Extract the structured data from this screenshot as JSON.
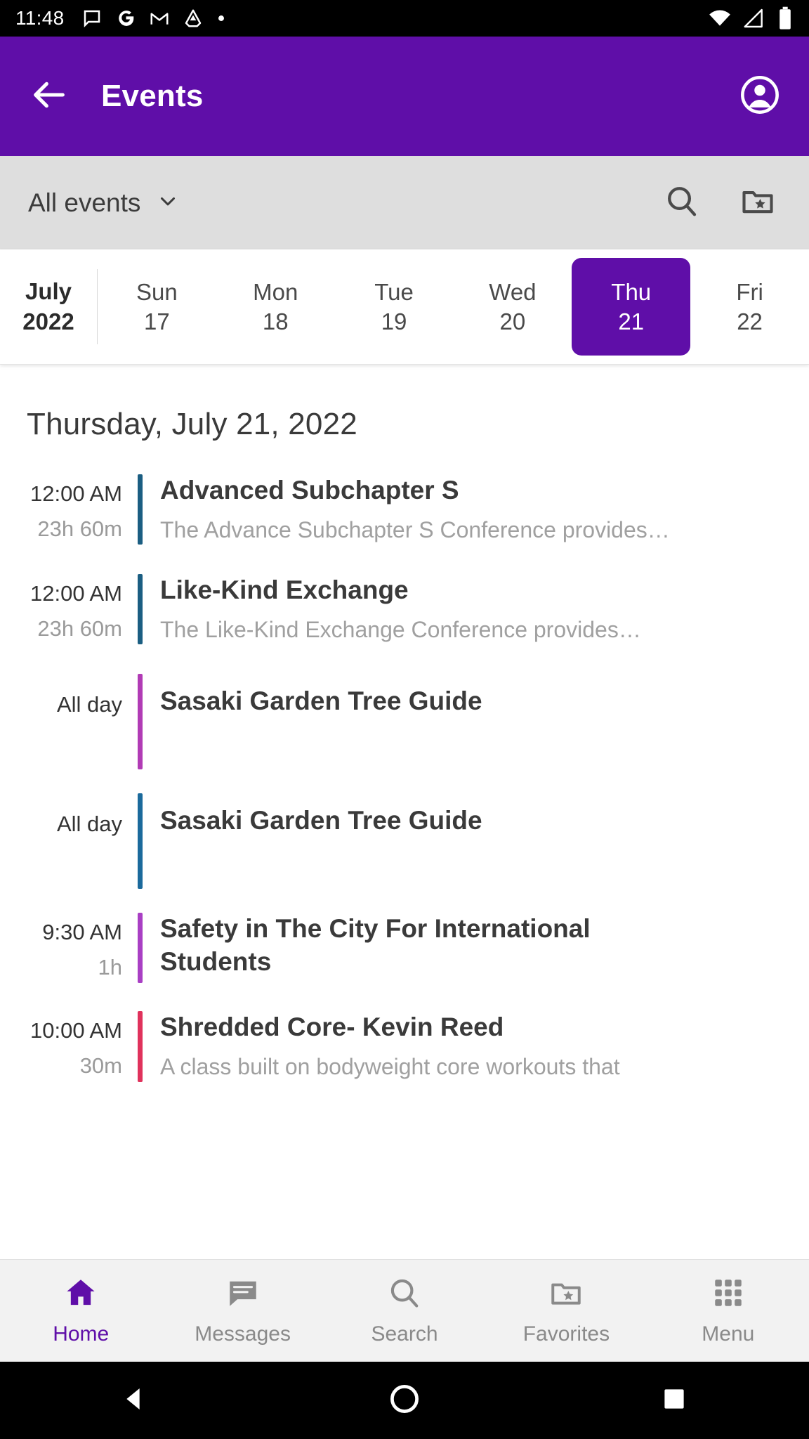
{
  "status_bar": {
    "time": "11:48",
    "left_icons": [
      "messages-icon",
      "google-icon",
      "gmail-icon",
      "drive-icon",
      "dot-icon"
    ],
    "right_icons": [
      "wifi-icon",
      "cell-signal-icon",
      "battery-icon"
    ]
  },
  "app_bar": {
    "title": "Events",
    "back_icon": "back-arrow-icon",
    "avatar_icon": "account-circle-icon",
    "background": "#5F0EA8"
  },
  "filter_bar": {
    "selected_filter": "All events",
    "chevron_icon": "chevron-down-icon",
    "search_icon": "search-icon",
    "favorites_icon": "folder-star-icon",
    "background": "#DEDEDE"
  },
  "week_strip": {
    "month": "July",
    "year": "2022",
    "days": [
      {
        "name": "Sun",
        "num": "17",
        "selected": false
      },
      {
        "name": "Mon",
        "num": "18",
        "selected": false
      },
      {
        "name": "Tue",
        "num": "19",
        "selected": false
      },
      {
        "name": "Wed",
        "num": "20",
        "selected": false
      },
      {
        "name": "Thu",
        "num": "21",
        "selected": true
      },
      {
        "name": "Fri",
        "num": "22",
        "selected": false
      }
    ],
    "selected_color": "#5F0EA8"
  },
  "main": {
    "date_heading": "Thursday, July 21, 2022",
    "events": [
      {
        "start": "12:00 AM",
        "duration": "23h 60m",
        "title": "Advanced Subchapter S",
        "description": "The Advance Subchapter S Conference provides…",
        "color": "#1B5E82"
      },
      {
        "start": "12:00 AM",
        "duration": "23h 60m",
        "title": "Like-Kind Exchange",
        "description": "The Like-Kind Exchange Conference provides…",
        "color": "#1B5E82"
      },
      {
        "start": "All day",
        "duration": "",
        "title": "Sasaki Garden Tree Guide",
        "description": "",
        "color": "#B13BB5"
      },
      {
        "start": "All day",
        "duration": "",
        "title": "Sasaki Garden Tree Guide",
        "description": "",
        "color": "#1B6A9C"
      },
      {
        "start": "9:30 AM",
        "duration": "1h",
        "title": "Safety in The City For International Students",
        "description": "",
        "color": "#A93FC4"
      },
      {
        "start": "10:00 AM",
        "duration": "30m",
        "title": "Shredded Core- Kevin Reed",
        "description": "A class built on bodyweight core workouts that",
        "color": "#E0325C"
      }
    ]
  },
  "bottom_nav": {
    "items": [
      {
        "label": "Home",
        "icon": "home-icon",
        "active": true
      },
      {
        "label": "Messages",
        "icon": "messages-icon",
        "active": false
      },
      {
        "label": "Search",
        "icon": "search-icon",
        "active": false
      },
      {
        "label": "Favorites",
        "icon": "folder-star-icon",
        "active": false
      },
      {
        "label": "Menu",
        "icon": "grid-menu-icon",
        "active": false
      }
    ],
    "active_color": "#5F0EA8",
    "inactive_color": "#8A8A8A"
  },
  "system_nav": {
    "back_icon": "triangle-back-icon",
    "home_icon": "circle-home-icon",
    "recents_icon": "square-recents-icon"
  }
}
